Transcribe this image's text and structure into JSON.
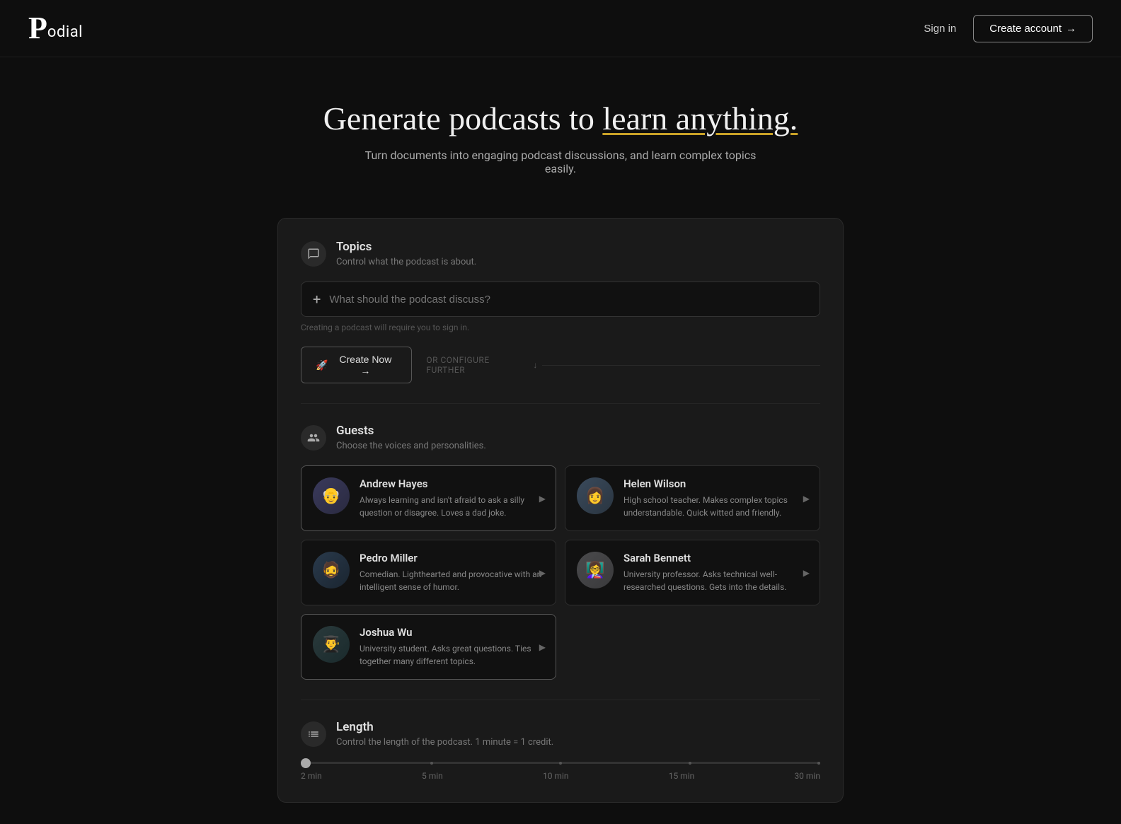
{
  "header": {
    "logo_letter": "P",
    "logo_rest": "odial",
    "sign_in_label": "Sign in",
    "create_account_label": "Create account",
    "create_account_arrow": "→"
  },
  "hero": {
    "headline_plain": "Generate podcasts to ",
    "headline_emphasis": "learn anything.",
    "subheadline": "Turn documents into engaging podcast discussions, and learn complex topics easily."
  },
  "topics_section": {
    "title": "Topics",
    "subtitle": "Control what the podcast is about.",
    "input_placeholder": "What should the podcast discuss?",
    "hint": "Creating a podcast will require you to sign in.",
    "create_now_label": "Create Now →",
    "or_configure_label": "OR CONFIGURE FURTHER"
  },
  "guests_section": {
    "title": "Guests",
    "subtitle": "Choose the voices and personalities.",
    "guests": [
      {
        "id": "andrew-hayes",
        "name": "Andrew Hayes",
        "description": "Always learning and isn't afraid to ask a silly question or disagree. Loves a dad joke.",
        "avatar_emoji": "👴",
        "avatar_class": "avatar-andrew",
        "selected": true
      },
      {
        "id": "helen-wilson",
        "name": "Helen Wilson",
        "description": "High school teacher. Makes complex topics understandable. Quick witted and friendly.",
        "avatar_emoji": "👩",
        "avatar_class": "avatar-helen",
        "selected": false
      },
      {
        "id": "pedro-miller",
        "name": "Pedro Miller",
        "description": "Comedian. Lighthearted and provocative with an intelligent sense of humor.",
        "avatar_emoji": "🧔",
        "avatar_class": "avatar-pedro",
        "selected": false
      },
      {
        "id": "sarah-bennett",
        "name": "Sarah Bennett",
        "description": "University professor. Asks technical well-researched questions. Gets into the details.",
        "avatar_emoji": "👩‍🏫",
        "avatar_class": "avatar-sarah",
        "selected": false
      },
      {
        "id": "joshua-wu",
        "name": "Joshua Wu",
        "description": "University student. Asks great questions. Ties together many different topics.",
        "avatar_emoji": "👨‍🎓",
        "avatar_class": "avatar-joshua",
        "selected": true
      }
    ]
  },
  "length_section": {
    "title": "Length",
    "subtitle": "Control the length of the podcast. 1 minute = 1 credit.",
    "labels": [
      "2 min",
      "5 min",
      "10 min",
      "15 min",
      "30 min"
    ],
    "current_value": "2 min",
    "thumb_position_percent": 0
  },
  "colors": {
    "accent_underline": "#c9a227",
    "bg_primary": "#0e0e0e",
    "bg_card": "#1a1a1a",
    "bg_input": "#111111"
  }
}
